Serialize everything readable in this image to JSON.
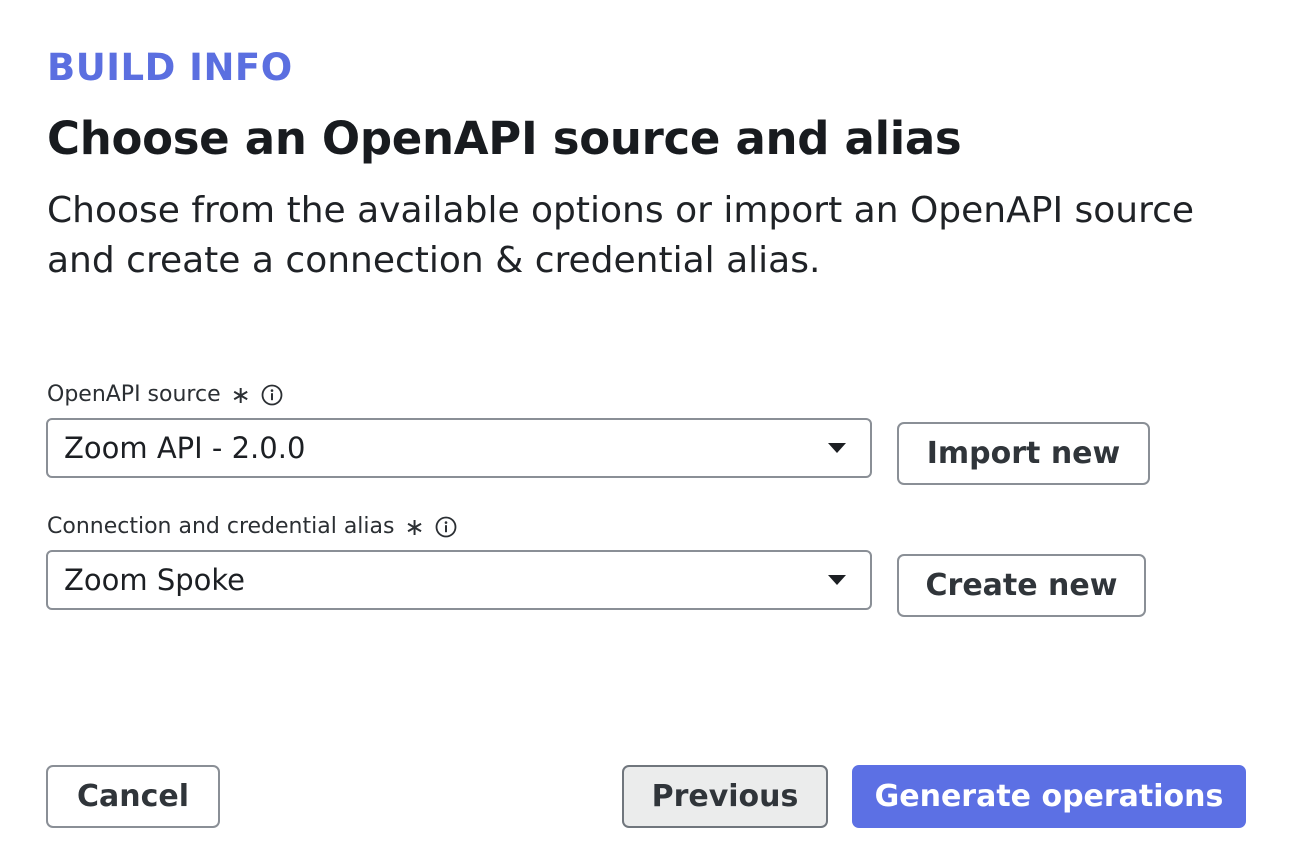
{
  "header": {
    "eyebrow": "BUILD INFO",
    "title": "Choose an OpenAPI source and alias",
    "description": "Choose from the available options or import an OpenAPI source and create a connection & credential alias."
  },
  "form": {
    "source": {
      "label": "OpenAPI source",
      "required_mark": "∗",
      "value": "Zoom API - 2.0.0",
      "action_label": "Import new"
    },
    "alias": {
      "label": "Connection and credential alias",
      "required_mark": "∗",
      "value": "Zoom Spoke",
      "action_label": "Create new"
    }
  },
  "footer": {
    "cancel_label": "Cancel",
    "previous_label": "Previous",
    "generate_label": "Generate operations"
  },
  "colors": {
    "accent": "#5c70e4",
    "eyebrow": "#5b6fe0"
  },
  "icons": {
    "info": "info-icon",
    "required": "asterisk-icon",
    "dropdown": "caret-down-icon"
  }
}
